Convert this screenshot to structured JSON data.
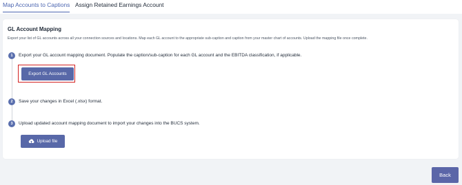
{
  "tabs": [
    {
      "label": "Map Accounts to Captions",
      "active": true
    },
    {
      "label": "Assign Retained Earnings Account",
      "active": false
    }
  ],
  "card": {
    "title": "GL Account Mapping",
    "description": "Export your list of GL accounts across all your connection sources and locations. Map each GL account to the appropriate sub-caption and caption from your master chart of accounts. Upload the mapping file once complete."
  },
  "steps": [
    {
      "number": "1",
      "text": "Export your GL account mapping document. Populate the caption/sub-caption for each GL account and the EBITDA classification, if applicable."
    },
    {
      "number": "2",
      "text": "Save your changes in Excel (.xlsx) format."
    },
    {
      "number": "3",
      "text": "Upload updated account mapping document to import your changes into the BUCS system."
    }
  ],
  "buttons": {
    "export_label": "Export GL Accounts",
    "upload_label": "Upload file",
    "back_label": "Back"
  },
  "icons": {
    "upload": "cloud-upload-icon"
  },
  "colors": {
    "accent": "#4b65b0",
    "button": "#5868a8",
    "highlight": "#d22020",
    "background": "#f1f3f6"
  }
}
